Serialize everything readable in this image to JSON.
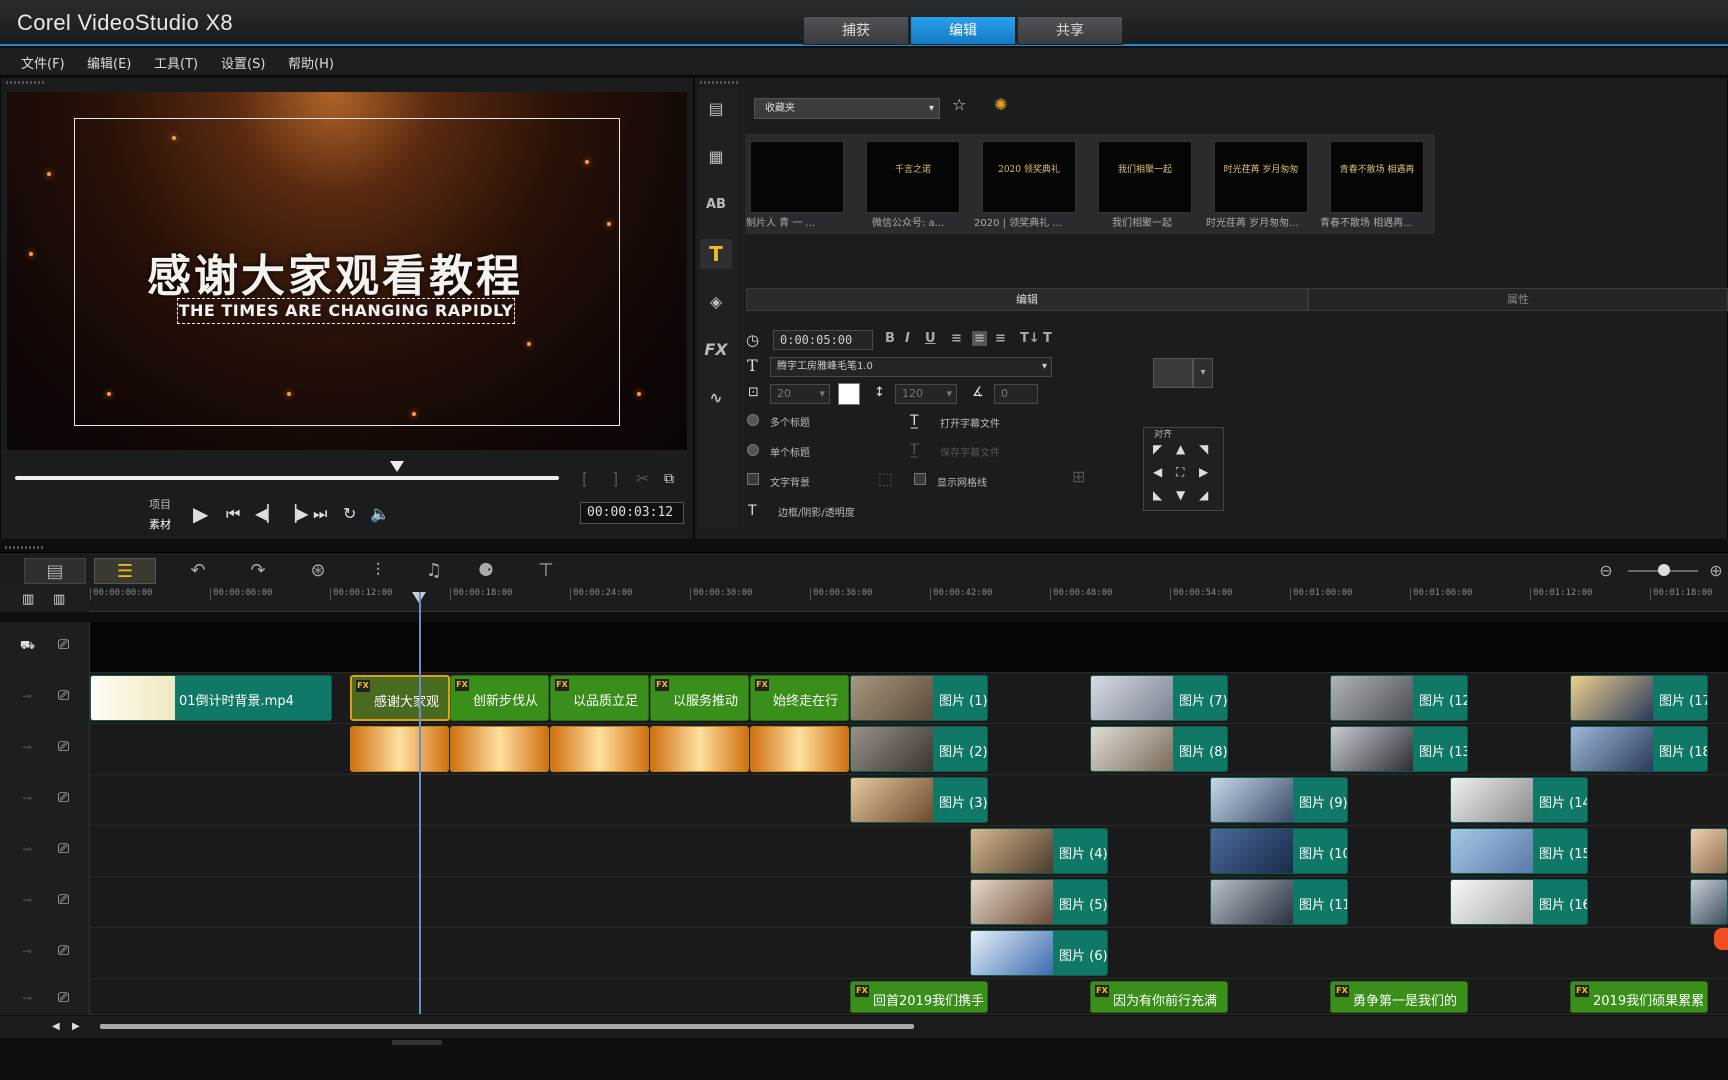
{
  "app": {
    "title": "Corel VideoStudio X8"
  },
  "main_tabs": [
    {
      "label": "捕获"
    },
    {
      "label": "编辑"
    },
    {
      "label": "共享"
    }
  ],
  "menu": [
    {
      "label": "文件(F)"
    },
    {
      "label": "编辑(E)"
    },
    {
      "label": "工具(T)"
    },
    {
      "label": "设置(S)"
    },
    {
      "label": "帮助(H)"
    }
  ],
  "preview": {
    "title_cn": "感谢大家观看教程",
    "title_en": "THE TIMES ARE CHANGING RAPIDLY",
    "mode_project": "项目",
    "mode_clip": "素材",
    "timecode": "00:00:03:12"
  },
  "library": {
    "favorites": "收藏夹",
    "thumbnails": [
      {
        "caption": "制片人  青  一  ...",
        "text": ""
      },
      {
        "caption": "微信公众号: a...",
        "text": "千言之诺"
      },
      {
        "caption": "2020 | 领奖典礼 ...",
        "text": "2020 领奖典礼"
      },
      {
        "caption": "我们相聚一起",
        "text": "我们相聚一起"
      },
      {
        "caption": "时光荏苒 岁月匆匆...",
        "text": "时光荏苒 岁月匆匆"
      },
      {
        "caption": "青春不散场 相遇再...",
        "text": "青春不散场 相遇再"
      }
    ]
  },
  "options": {
    "tab_edit": "编辑",
    "tab_attr": "属性",
    "duration": "0:00:05:00",
    "font": "腾字工房雅峰毛笔1.0",
    "font_size": "20",
    "line_spacing": "120",
    "angle": "0",
    "multi_title": "多个标题",
    "single_title": "单个标题",
    "text_bg": "文字背景",
    "open_subtitle": "打开字幕文件",
    "save_subtitle": "保存字幕文件",
    "show_grid": "显示网格线",
    "border_shadow": "边框/阴影/透明度",
    "align": "对齐"
  },
  "ruler": [
    "00:00:00:00",
    "00:00:06:00",
    "00:00:12:00",
    "00:00:18:00",
    "00:00:24:00",
    "00:00:30:00",
    "00:00:36:00",
    "00:00:42:00",
    "00:00:48:00",
    "00:00:54:00",
    "00:01:00:00",
    "00:01:06:00",
    "00:01:12:00",
    "00:01:18:00"
  ],
  "clips": {
    "v1": [
      "01倒计时背景.mp4",
      "感谢大家观",
      "创新步伐从",
      "以品质立足",
      "以服务推动",
      "始终走在行",
      "图片 (1).",
      "图片 (7).",
      "图片 (12",
      "图片 (17"
    ],
    "o1": [
      "图片 (2).",
      "图片 (8).",
      "图片 (13",
      "图片 (18"
    ],
    "o2": [
      "图片 (3).",
      "图片 (9).",
      "图片 (14"
    ],
    "o3": [
      "图片 (4).",
      "图片 (10",
      "图片 (15"
    ],
    "o4": [
      "图片 (5).",
      "图片 (11",
      "图片 (16"
    ],
    "o5": [
      "图片 (6)."
    ],
    "t1": [
      "回首2019我们携手",
      "因为有你前行充满",
      "勇争第一是我们的",
      "2019我们硕果累累"
    ]
  }
}
